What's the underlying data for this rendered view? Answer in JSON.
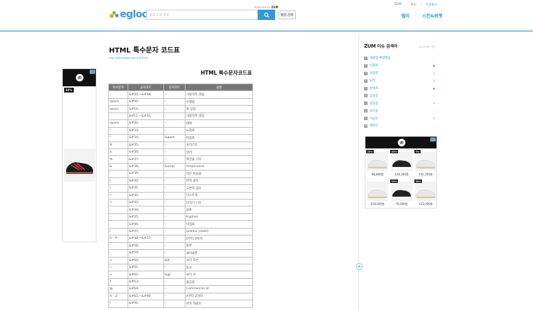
{
  "header": {
    "logo_text": "egloos",
    "powered": "Powered by",
    "powered_brand": "ZUM",
    "search_placeholder": "블로그 글 검색",
    "integrated_search": "통합 검색",
    "top_links": [
      "ZUM",
      "뉴스",
      "이글루스"
    ],
    "tabs": [
      "밸리",
      "스킨&위젯"
    ]
  },
  "post": {
    "title": "HTML 특수문자 코드표",
    "link": "http://bitty.egloos.com/1163940",
    "table_heading": "HTML 특수문자코드표",
    "columns": [
      "특수문자",
      "숫자코드",
      "문자코드",
      "설명"
    ],
    "rows": [
      [
        "–",
        "&#00;~&#08;",
        "–",
        "사용하지 않음"
      ],
      [
        "space",
        "&#09;",
        "–",
        "수평탭"
      ],
      [
        "space",
        "&#10;",
        "–",
        "줄 삽입"
      ],
      [
        "–",
        "&#11;~&#31;",
        "–",
        "사용하지 않음"
      ],
      [
        "space",
        "&#32;",
        "–",
        "여백"
      ],
      [
        "!",
        "&#33;",
        "–",
        "느낌표"
      ],
      [
        "\"",
        "&#34;",
        "&quot;",
        "따옴표"
      ],
      [
        "#",
        "&#35;",
        "–",
        "숫자기호"
      ],
      [
        "$",
        "&#36;",
        "–",
        "달러"
      ],
      [
        "%",
        "&#37;",
        "–",
        "백분율 기호"
      ],
      [
        "&",
        "&#38;",
        "&amp;",
        "Ampersand"
      ],
      [
        "'",
        "&#39;",
        "–",
        "작은 따옴표"
      ],
      [
        "(",
        "&#40;",
        "–",
        "왼쪽 괄호"
      ],
      [
        ")",
        "&#41;",
        "–",
        "오른쪽 괄호"
      ],
      [
        "*",
        "&#42;",
        "–",
        "아스트릭"
      ],
      [
        "+",
        "&#43;",
        "–",
        "더하기 기호"
      ],
      [
        ",",
        "&#44;",
        "–",
        "쉼표"
      ],
      [
        "–",
        "&#45;",
        "–",
        "Hyphen"
      ],
      [
        ".",
        "&#46;",
        "–",
        "마침표"
      ],
      [
        "/",
        "&#47;",
        "–",
        "Solidus (slash)"
      ],
      [
        "0 – 9",
        "&#48;~&#57;",
        "–",
        "0부터 9까지"
      ],
      [
        ":",
        "&#58;",
        "–",
        "콜론"
      ],
      [
        ";",
        "&#59;",
        "–",
        "세미콜론"
      ],
      [
        "<",
        "&#60;",
        "&lt;",
        "보다 작은"
      ],
      [
        "=",
        "&#61;",
        "–",
        "등호"
      ],
      [
        ">",
        "&#62;",
        "&gt;",
        "보다 큰"
      ],
      [
        "?",
        "&#63;",
        "–",
        "물음표"
      ],
      [
        "@",
        "&#64;",
        "–",
        "Commercial at"
      ],
      [
        "A – Z",
        "&#65;~&#90;",
        "–",
        "A부터 Z까지"
      ],
      [
        "[",
        "&#91;",
        "–",
        "왼쪽 대괄호"
      ]
    ]
  },
  "left_ad": {
    "brand": "JD",
    "discount": "32%"
  },
  "ranking": {
    "brand": "ZUM",
    "title": "이슈 검색어",
    "time": "12:15 PM 기준",
    "items": [
      {
        "num": "1",
        "label": "개봉일 확정했음",
        "change": "–",
        "color": "#f08a24"
      },
      {
        "num": "2",
        "label": "이정희",
        "change": "▼",
        "color": "#e04040"
      },
      {
        "num": "3",
        "label": "김연희",
        "change": "+",
        "color": "#2e9ad8"
      },
      {
        "num": "4",
        "label": "탐특",
        "change": "+",
        "color": "#2e9ad8"
      },
      {
        "num": "5",
        "label": "윤범조",
        "change": "▼",
        "color": "#e04040"
      },
      {
        "num": "6",
        "label": "임효중",
        "change": "–",
        "color": "#f08a24"
      },
      {
        "num": "7",
        "label": "송중립",
        "change": "+",
        "color": "#2e9ad8"
      },
      {
        "num": "8",
        "label": "조우승",
        "change": "–",
        "color": "#f08a24"
      },
      {
        "num": "9",
        "label": "가방은",
        "change": "+",
        "color": "#2e9ad8"
      },
      {
        "num": "10",
        "label": "새론선",
        "change": "–",
        "color": "#f08a24"
      }
    ]
  },
  "right_ad": {
    "brand": "JD",
    "products": [
      {
        "badge": "23%",
        "price": "98,800원"
      },
      {
        "badge": "33%",
        "price": "128,300원"
      },
      {
        "badge": "5%",
        "price": "141,550원"
      },
      {
        "badge": "",
        "price": "159,000원"
      },
      {
        "badge": "23%",
        "price": "76,000원"
      },
      {
        "badge": "30%",
        "price": "153,000원"
      }
    ]
  },
  "colors": {
    "accent": "#2e9ad8",
    "table_header": "#777777",
    "ad_dark": "#111111"
  }
}
